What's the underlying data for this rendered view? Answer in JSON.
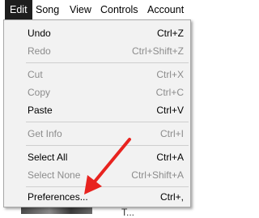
{
  "menubar": {
    "items": [
      {
        "label": "Edit",
        "active": true
      },
      {
        "label": "Song"
      },
      {
        "label": "View"
      },
      {
        "label": "Controls"
      },
      {
        "label": "Account"
      }
    ]
  },
  "edit_menu": {
    "items": [
      {
        "label": "Undo",
        "shortcut": "Ctrl+Z",
        "enabled": true
      },
      {
        "label": "Redo",
        "shortcut": "Ctrl+Shift+Z",
        "enabled": false
      },
      {
        "label": "Cut",
        "shortcut": "Ctrl+X",
        "enabled": false
      },
      {
        "label": "Copy",
        "shortcut": "Ctrl+C",
        "enabled": false
      },
      {
        "label": "Paste",
        "shortcut": "Ctrl+V",
        "enabled": true
      },
      {
        "label": "Get Info",
        "shortcut": "Ctrl+I",
        "enabled": false
      },
      {
        "label": "Select All",
        "shortcut": "Ctrl+A",
        "enabled": true
      },
      {
        "label": "Select None",
        "shortcut": "Ctrl+Shift+A",
        "enabled": false
      },
      {
        "label": "Preferences...",
        "shortcut": "Ctrl+,",
        "enabled": true
      }
    ]
  },
  "background": {
    "partial_text": "T... "
  },
  "annotation": {
    "arrow_color": "#e8231f"
  }
}
